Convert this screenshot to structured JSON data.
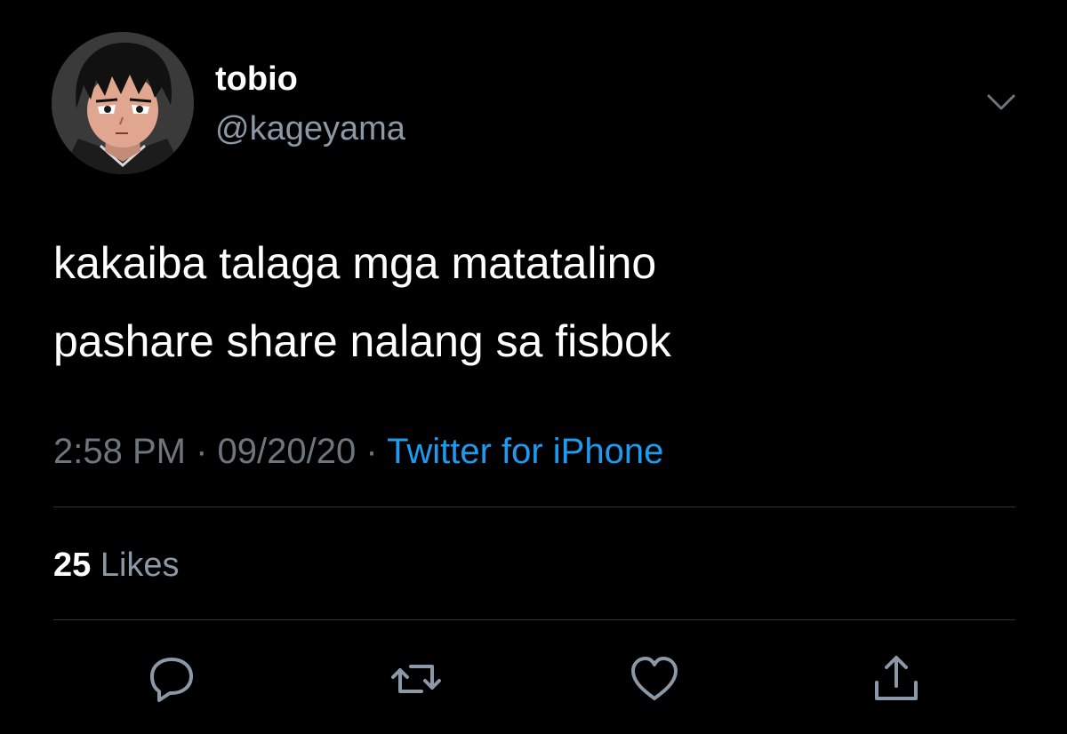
{
  "tweet": {
    "display_name": "tobio",
    "handle": "@kageyama",
    "text_lines": [
      "kakaiba talaga mga matatalino",
      "pashare share nalang sa fisbok"
    ],
    "time": "2:58 PM",
    "separator": "·",
    "date": "09/20/20",
    "source": "Twitter for iPhone",
    "likes_count": "25",
    "likes_label": "Likes"
  },
  "icons": {
    "menu": "chevron-down-icon",
    "reply": "reply-icon",
    "retweet": "retweet-icon",
    "like": "heart-icon",
    "share": "share-icon"
  },
  "colors": {
    "background": "#000000",
    "primary_text": "#ffffff",
    "secondary_text": "#8b98a5",
    "link": "#1d9bf0",
    "divider": "#2f3336"
  }
}
